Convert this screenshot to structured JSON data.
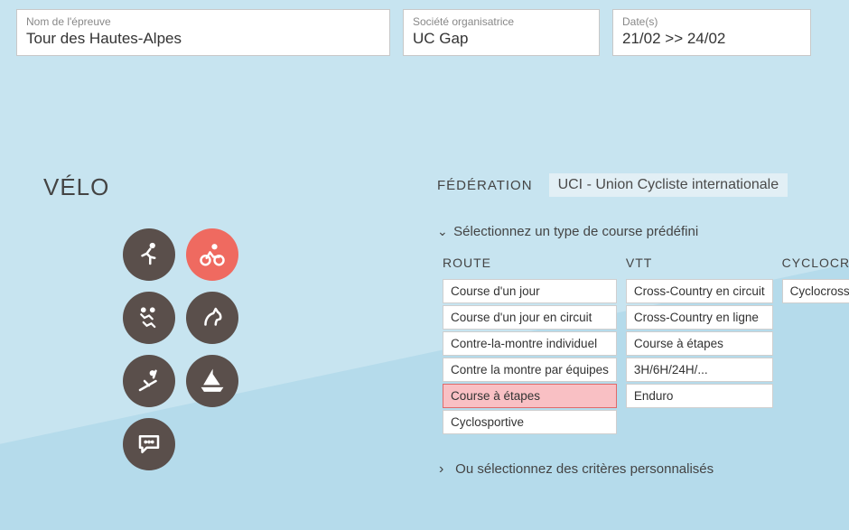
{
  "fields": {
    "name": {
      "label": "Nom de l'épreuve",
      "value": "Tour des Hautes-Alpes"
    },
    "org": {
      "label": "Société organisatrice",
      "value": "UC Gap"
    },
    "date": {
      "label": "Date(s)",
      "value": "21/02 >> 24/02"
    }
  },
  "sport_title": "VÉLO",
  "federation": {
    "label": "FÉDÉRATION",
    "value": "UCI - Union Cycliste internationale"
  },
  "type_section": {
    "toggle_label": "Sélectionnez un type de course prédéfini",
    "columns": {
      "route": {
        "heading": "ROUTE",
        "items": [
          "Course d'un jour",
          "Course d'un jour en circuit",
          "Contre-la-montre individuel",
          "Contre la montre par équipes",
          "Course à étapes",
          "Cyclosportive"
        ],
        "selected_index": 4
      },
      "vtt": {
        "heading": "VTT",
        "items": [
          "Cross-Country en circuit",
          "Cross-Country en ligne",
          "Course à étapes",
          "3H/6H/24H/...",
          "Enduro"
        ]
      },
      "cx": {
        "heading": "CYCLOCROSS",
        "items": [
          "Cyclocross"
        ]
      }
    }
  },
  "alt_toggle_label": "Ou sélectionnez des critères personnalisés"
}
